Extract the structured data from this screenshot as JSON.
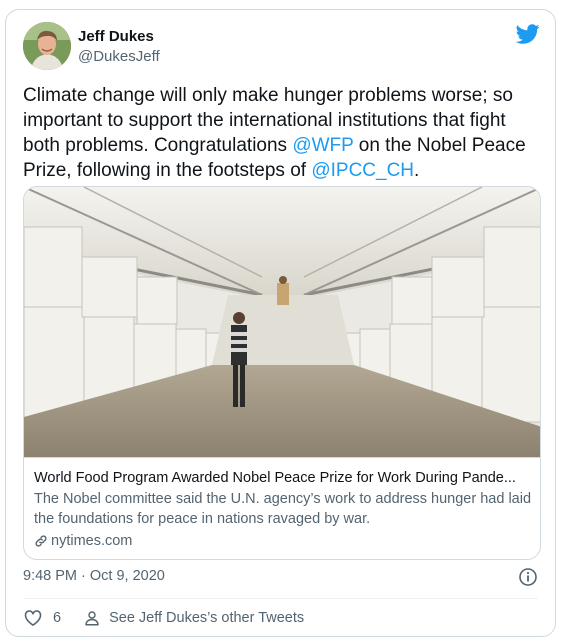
{
  "author": {
    "name": "Jeff Dukes",
    "handle": "@DukesJeff",
    "avatar_icon": "profile-photo"
  },
  "tweet": {
    "text_segments": [
      {
        "text": "Climate change will only make hunger problems worse; so important to support the international institutions that fight both problems. Congratulations ",
        "mention": false
      },
      {
        "text": "@WFP",
        "mention": true
      },
      {
        "text": " on the Nobel Peace Prize, following in the footsteps of ",
        "mention": false
      },
      {
        "text": "@IPCC_CH",
        "mention": true
      },
      {
        "text": ".",
        "mention": false
      }
    ]
  },
  "link_card": {
    "title": "World Food Program Awarded Nobel Peace Prize for Work During Pande...",
    "description": "The Nobel committee said the U.N. agency’s work to address hunger had laid the foundations for peace in nations ravaged by war.",
    "domain": "nytimes.com"
  },
  "meta": {
    "timestamp": "9:48 PM · Oct 9, 2020"
  },
  "actions": {
    "like_count": "6",
    "profile_link": "See Jeff Dukes’s other Tweets"
  },
  "colors": {
    "accent": "#1d9bf0",
    "secondary_text": "#536471",
    "border": "#cfd9de"
  }
}
